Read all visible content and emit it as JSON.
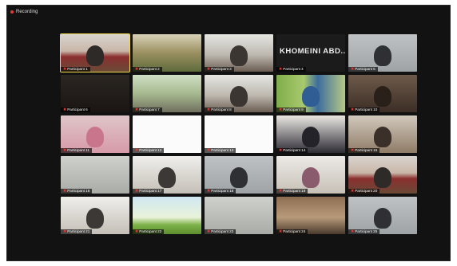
{
  "window": {
    "recording_label": "Recording"
  },
  "tiles": [
    {
      "name": "Participant 1",
      "active": true,
      "theme": "room-red"
    },
    {
      "name": "Participant 2",
      "theme": "room-green"
    },
    {
      "name": "Participant 3",
      "theme": "office"
    },
    {
      "name": "Participant 4",
      "theme": "black-name",
      "big_text": "KHOMEINI ABD..."
    },
    {
      "name": "Participant 5",
      "theme": "person-grey"
    },
    {
      "name": "Participant 6",
      "theme": "dark"
    },
    {
      "name": "Participant 7",
      "theme": "office-green"
    },
    {
      "name": "Participant 8",
      "theme": "office"
    },
    {
      "name": "Participant 9",
      "theme": "hijab-blue"
    },
    {
      "name": "Participant 10",
      "theme": "dark-room"
    },
    {
      "name": "Participant 11",
      "theme": "pink"
    },
    {
      "name": "Participant 12",
      "theme": "logo-white"
    },
    {
      "name": "Participant 13",
      "theme": "logo-white"
    },
    {
      "name": "Participant 14",
      "theme": "hijab-dark"
    },
    {
      "name": "Participant 15",
      "theme": "person-office"
    },
    {
      "name": "Participant 16",
      "theme": "blur"
    },
    {
      "name": "Participant 17",
      "theme": "office-white"
    },
    {
      "name": "Participant 18",
      "theme": "person-grey"
    },
    {
      "name": "Participant 19",
      "theme": "hijab-light"
    },
    {
      "name": "Participant 20",
      "theme": "room-red"
    },
    {
      "name": "Participant 21",
      "theme": "office-white"
    },
    {
      "name": "Participant 22",
      "theme": "nature"
    },
    {
      "name": "Participant 23",
      "theme": "blur"
    },
    {
      "name": "Participant 24",
      "theme": "room-brown"
    },
    {
      "name": "Participant 25",
      "theme": "person-grey"
    }
  ],
  "colors": {
    "active_border": "#f2d94c",
    "mic_muted": "#e53935",
    "background": "#121212"
  }
}
